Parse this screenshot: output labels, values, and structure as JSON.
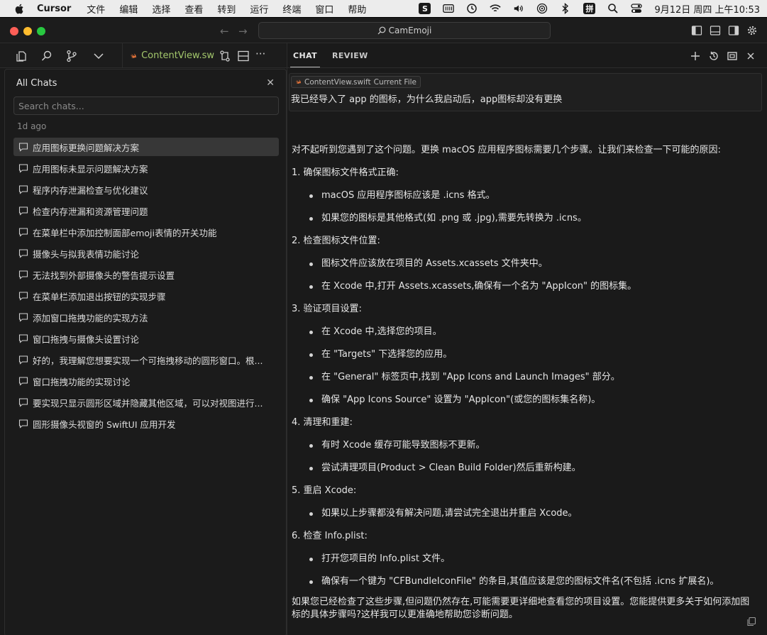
{
  "menubar": {
    "app": "Cursor",
    "items": [
      "文件",
      "编辑",
      "选择",
      "查看",
      "转到",
      "运行",
      "终端",
      "窗口",
      "帮助"
    ],
    "ime": "拼",
    "datetime": "9月12日 周四 上午10:53"
  },
  "window": {
    "search": "CamEmoji"
  },
  "editor": {
    "tab_label": "ContentView.sw"
  },
  "chats_panel": {
    "title": "All Chats",
    "search_placeholder": "Search chats...",
    "section": "1d ago",
    "items": [
      "应用图标更换问题解决方案",
      "应用图标未显示问题解决方案",
      "程序内存泄漏检查与优化建议",
      "检查内存泄漏和资源管理问题",
      "在菜单栏中添加控制面部emoji表情的开关功能",
      "摄像头与拟我表情功能讨论",
      "无法找到外部摄像头的警告提示设置",
      "在菜单栏添加退出按钮的实现步骤",
      "添加窗口拖拽功能的实现方法",
      "窗口拖拽与摄像头设置讨论",
      "好的，我理解您想要实现一个可拖拽移动的圆形窗口。根...",
      "窗口拖拽功能的实现讨论",
      "要实现只显示圆形区域并隐藏其他区域，可以对视图进行...",
      "圆形摄像头视窗的 SwiftUI 应用开发"
    ]
  },
  "right": {
    "tab_chat": "CHAT",
    "tab_review": "REVIEW",
    "file_chip": "ContentView.swift",
    "file_chip_note": "Current File",
    "user_message": "我已经导入了 app 的图标，为什么我启动后，app图标却没有更换",
    "answer": {
      "intro": "对不起听到您遇到了这个问题。更换 macOS 应用程序图标需要几个步骤。让我们来检查一下可能的原因:",
      "s1": "1. 确保图标文件格式正确:",
      "s1b1": "macOS 应用程序图标应该是 .icns 格式。",
      "s1b2": "如果您的图标是其他格式(如 .png 或 .jpg),需要先转换为 .icns。",
      "s2": "2. 检查图标文件位置:",
      "s2b1": "图标文件应该放在项目的 Assets.xcassets 文件夹中。",
      "s2b2": "在 Xcode 中,打开 Assets.xcassets,确保有一个名为 \"AppIcon\" 的图标集。",
      "s3": "3. 验证项目设置:",
      "s3b1": "在 Xcode 中,选择您的项目。",
      "s3b2": "在 \"Targets\" 下选择您的应用。",
      "s3b3": "在 \"General\" 标签页中,找到 \"App Icons and Launch Images\" 部分。",
      "s3b4": "确保 \"App Icons Source\" 设置为 \"AppIcon\"(或您的图标集名称)。",
      "s4": "4. 清理和重建:",
      "s4b1": "有时 Xcode 缓存可能导致图标不更新。",
      "s4b2": "尝试清理项目(Product > Clean Build Folder)然后重新构建。",
      "s5": "5. 重启 Xcode:",
      "s5b1": "如果以上步骤都没有解决问题,请尝试完全退出并重启 Xcode。",
      "s6": "6. 检查 Info.plist:",
      "s6b1": "打开您项目的 Info.plist 文件。",
      "s6b2": "确保有一个键为 \"CFBundleIconFile\" 的条目,其值应该是您的图标文件名(不包括 .icns 扩展名)。",
      "outro": "如果您已经检查了这些步骤,但问题仍然存在,可能需要更详细地查看您的项目设置。您能提供更多关于如何添加图标的具体步骤吗?这样我可以更准确地帮助您诊断问题。"
    }
  },
  "colors": {
    "accent_swift": "#e8753a",
    "file_tab_text": "#a4c86c"
  }
}
